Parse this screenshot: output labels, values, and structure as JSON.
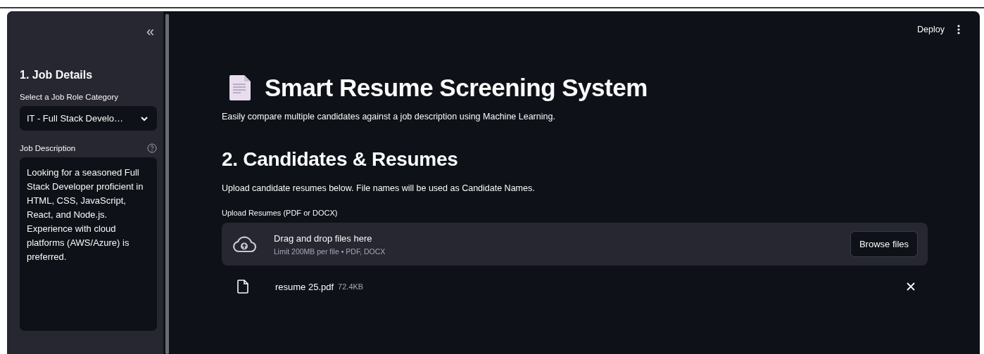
{
  "sidebar": {
    "collapse_icon": "«",
    "heading": "1. Job Details",
    "job_role": {
      "label": "Select a Job Role Category",
      "value": "IT - Full Stack Develo…"
    },
    "job_description": {
      "label": "Job Description",
      "value": "Looking for a seasoned Full Stack Developer proficient in HTML, CSS, JavaScript, React, and Node.js. Experience with cloud platforms (AWS/Azure) is preferred."
    }
  },
  "header": {
    "deploy": "Deploy"
  },
  "main": {
    "title": "Smart Resume Screening System",
    "subtitle": "Easily compare multiple candidates against a job description using Machine Learning.",
    "section_heading": "2. Candidates & Resumes",
    "section_text": "Upload candidate resumes below. File names will be used as Candidate Names.",
    "uploader": {
      "label": "Upload Resumes (PDF or DOCX)",
      "drop_text": "Drag and drop files here",
      "limit_text": "Limit 200MB per file • PDF, DOCX",
      "button": "Browse files"
    },
    "files": [
      {
        "name": "resume 25.pdf",
        "size": "72.4KB"
      }
    ]
  }
}
